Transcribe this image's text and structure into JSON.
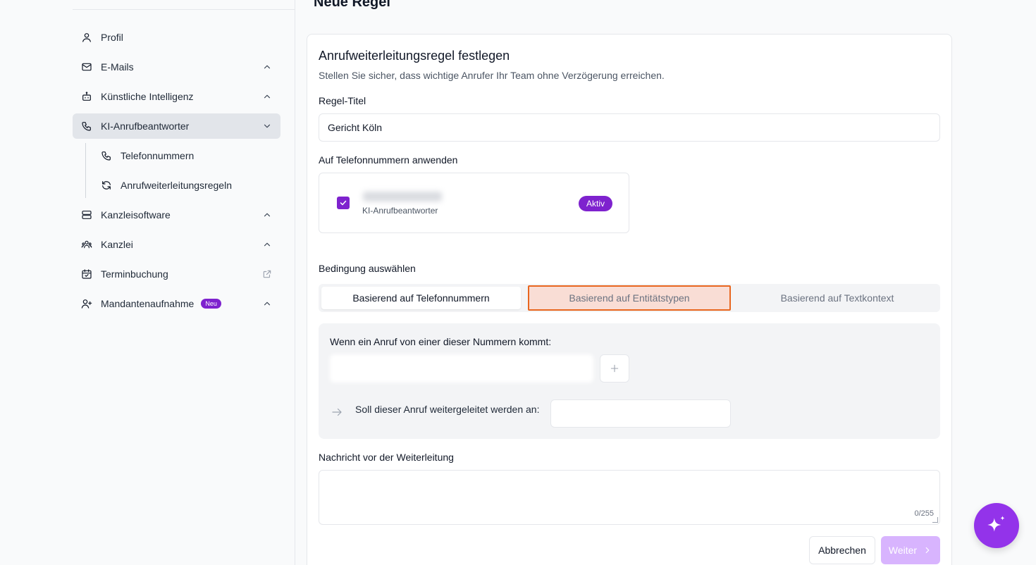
{
  "page": {
    "title": "Neue Regel"
  },
  "sidebar": {
    "items": [
      {
        "label": "Profil",
        "icon": "user-icon"
      },
      {
        "label": "E-Mails",
        "icon": "mail-icon"
      },
      {
        "label": "Künstliche Intelligenz",
        "icon": "bot-icon"
      },
      {
        "label": "KI-Anrufbeantworter",
        "icon": "phone-icon",
        "active": true
      },
      {
        "label": "Telefonnummern",
        "icon": "phone-icon"
      },
      {
        "label": "Anrufweiterleitungsregeln",
        "icon": "refresh-icon"
      },
      {
        "label": "Kanzleisoftware",
        "icon": "server-icon"
      },
      {
        "label": "Kanzlei",
        "icon": "users-icon"
      },
      {
        "label": "Terminbuchung",
        "icon": "calendar-check-icon"
      },
      {
        "label": "Mandantenaufnahme",
        "icon": "user-plus-icon",
        "badge": "Neu"
      }
    ]
  },
  "card": {
    "title": "Anrufweiterleitungsregel festlegen",
    "subtitle": "Stellen Sie sicher, dass wichtige Anrufer Ihr Team ohne Verzögerung erreichen.",
    "rule_title_label": "Regel-Titel",
    "rule_title_value": "Gericht Köln",
    "apply_label": "Auf Telefonnummern anwenden",
    "phone": {
      "subtitle": "KI-Anrufbeantworter",
      "status": "Aktiv",
      "checked": true
    },
    "condition_label": "Bedingung auswählen",
    "tabs": [
      "Basierend auf Telefonnummern",
      "Basierend auf Entitätstypen",
      "Basierend auf Textkontext"
    ],
    "condition": {
      "when_label": "Wenn ein Anruf von einer dieser Nummern kommt:",
      "forward_label": "Soll dieser Anruf weitergeleitet werden an:"
    },
    "message_label": "Nachricht vor der Weiterleitung",
    "message_counter": "0/255",
    "cancel_label": "Abbrechen",
    "next_label": "Weiter"
  },
  "colors": {
    "accent": "#7e22ce",
    "highlight_border": "#e8661f",
    "fab": "#9333ea"
  }
}
